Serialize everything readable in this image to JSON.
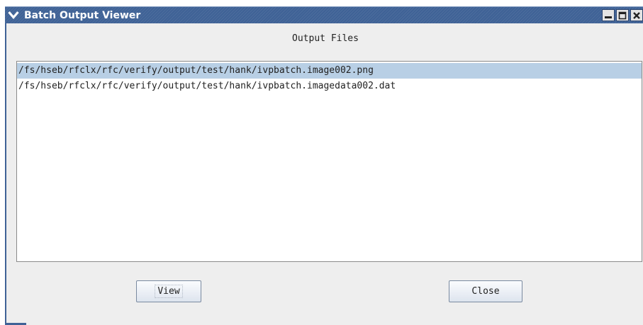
{
  "window": {
    "title": "Batch Output Viewer",
    "controls": [
      "minimize-icon",
      "maximize-icon",
      "close-icon"
    ],
    "accent_color": "#3f6296"
  },
  "main": {
    "header_label": "Output Files",
    "files": [
      "/fs/hseb/rfclx/rfc/verify/output/test/hank/ivpbatch.image002.png",
      "/fs/hseb/rfclx/rfc/verify/output/test/hank/ivpbatch.imagedata002.dat"
    ],
    "selected_index": 0,
    "selection_color": "#b8cfe5"
  },
  "buttons": {
    "view_label": "View",
    "close_label": "Close"
  }
}
